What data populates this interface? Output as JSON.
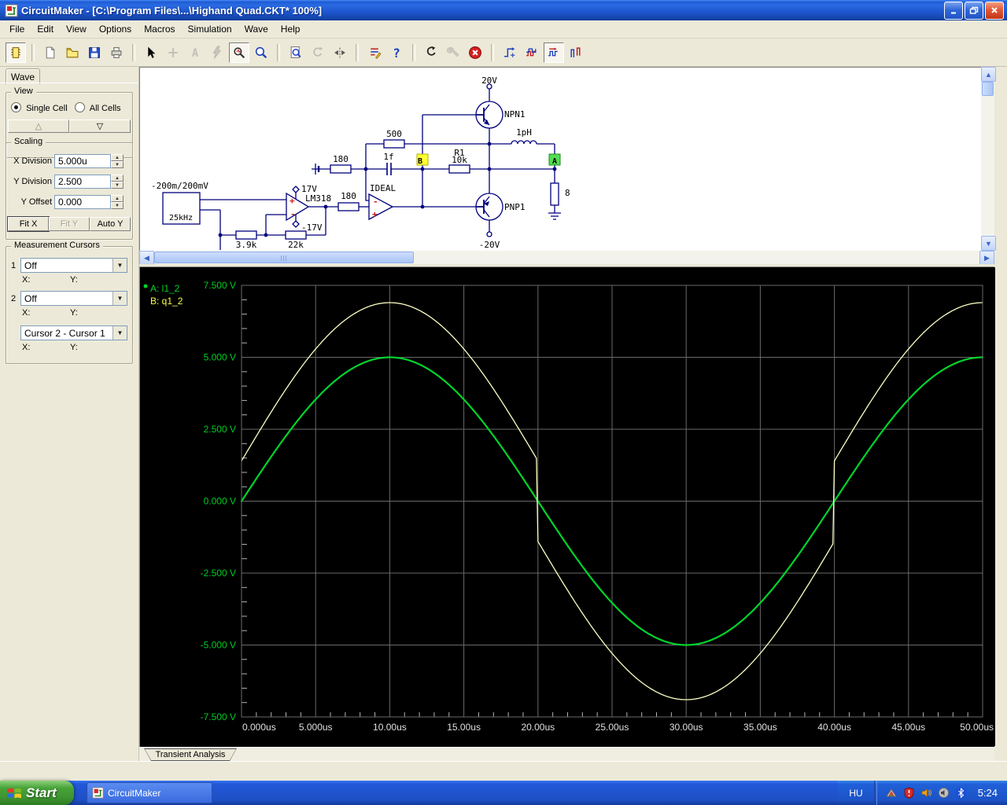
{
  "window": {
    "title": "CircuitMaker - [C:\\Program Files\\...\\Highand Quad.CKT* 100%]",
    "accent_color": "#1c54cc"
  },
  "menu": {
    "items": [
      "File",
      "Edit",
      "View",
      "Options",
      "Macros",
      "Simulation",
      "Wave",
      "Help"
    ]
  },
  "toolbar": {
    "buttons": [
      {
        "name": "parts-bin-icon",
        "type": "chip",
        "pressed": true
      },
      {
        "sep": true
      },
      {
        "name": "new-file-icon",
        "type": "file"
      },
      {
        "name": "open-file-icon",
        "type": "folder"
      },
      {
        "name": "save-icon",
        "type": "floppy"
      },
      {
        "name": "print-icon",
        "type": "printer"
      },
      {
        "sep": true
      },
      {
        "name": "arrow-tool-icon",
        "type": "arrow"
      },
      {
        "name": "wire-tool-icon",
        "type": "plus",
        "disabled": true
      },
      {
        "name": "text-tool-icon",
        "type": "letterA",
        "disabled": true
      },
      {
        "name": "delete-tool-icon",
        "type": "lightning",
        "disabled": true
      },
      {
        "name": "probe-tool-icon",
        "type": "probe",
        "pressed": true
      },
      {
        "name": "zoom-tool-icon",
        "type": "zoom"
      },
      {
        "sep": true
      },
      {
        "name": "zoom-area-icon",
        "type": "pagezoom"
      },
      {
        "name": "rotate-icon",
        "type": "rotate",
        "disabled": true
      },
      {
        "name": "mirror-icon",
        "type": "mirror"
      },
      {
        "sep": true
      },
      {
        "name": "simulation-setup-icon",
        "type": "simlist"
      },
      {
        "name": "help-icon",
        "type": "help"
      },
      {
        "sep": true
      },
      {
        "name": "reset-icon",
        "type": "reset"
      },
      {
        "name": "wrench-icon",
        "type": "wrench",
        "disabled": true
      },
      {
        "name": "stop-icon",
        "type": "stop"
      },
      {
        "sep": true
      },
      {
        "name": "operating-point-icon",
        "type": "wave1"
      },
      {
        "name": "digital-analysis-icon",
        "type": "wave2"
      },
      {
        "name": "transient-analysis-icon",
        "type": "wave3",
        "pressed": true
      },
      {
        "name": "mixed-signal-icon",
        "type": "wave4"
      }
    ]
  },
  "sidebar": {
    "tab": "Wave",
    "view": {
      "label": "View",
      "single_cell": "Single Cell",
      "all_cells": "All Cells",
      "up_glyph": "△",
      "down_glyph": "▽"
    },
    "scaling": {
      "label": "Scaling",
      "x_division_label": "X Division",
      "x_division": "5.000u",
      "y_division_label": "Y Division",
      "y_division": "2.500",
      "y_offset_label": "Y Offset",
      "y_offset": "0.000",
      "fit_x": "Fit X",
      "fit_y": "Fit Y",
      "auto_y": "Auto Y"
    },
    "cursors": {
      "label": "Measurement Cursors",
      "c1_num": "1",
      "c1_value": "Off",
      "c2_num": "2",
      "c2_value": "Off",
      "diff_value": "Cursor 2 - Cursor 1",
      "x_label": "X:",
      "y_label": "Y:"
    }
  },
  "schematic": {
    "labels": {
      "v20": "20V",
      "npn": "NPN1",
      "r500": "500",
      "l1": "1pH",
      "r180_top": "180",
      "c1f": "1f",
      "marker_b": "B",
      "r1_name": "R1",
      "r1_val": "10k",
      "marker_a": "A",
      "r8": "8",
      "pnp": "PNP1",
      "vneg20": "-20V",
      "src_range": "-200m/200mV",
      "src_freq": "25kHz",
      "vpos17": "17V",
      "opamp1": "LM318",
      "vneg17": "-17V",
      "r180_mid": "180",
      "opamp2": "IDEAL",
      "r39k": "3.9k",
      "r22k": "22k",
      "plus": "+",
      "minus": "-"
    },
    "wire_color": "#00007d",
    "marker_b_color": "#ffff33",
    "marker_a_color": "#55dd55"
  },
  "chart_data": {
    "type": "line",
    "title": "Transient Analysis",
    "x_axis": {
      "unit": "us",
      "min": 0,
      "max": 50,
      "major_step": 5,
      "minor_step": 1,
      "tick_labels": [
        "0.000us",
        "5.000us",
        "10.00us",
        "15.00us",
        "20.00us",
        "25.00us",
        "30.00us",
        "35.00us",
        "40.00us",
        "45.00us",
        "50.00us"
      ],
      "label_color": "#e0e0e0"
    },
    "y_axis": {
      "unit": "V",
      "min": -7.5,
      "max": 7.5,
      "major_step": 2.5,
      "minor_step": 0.5,
      "tick_labels": [
        "7.500 V",
        "5.000 V",
        "2.500 V",
        "0.000 V",
        "-2.500 V",
        "-5.000 V",
        "-7.500 V"
      ],
      "label_color": "#00cc22"
    },
    "grid": {
      "show": true,
      "color": "#6a6a6a",
      "tick_color": "#b4b4b4",
      "bg": "#000000"
    },
    "legend": {
      "position": "top-left",
      "entries": [
        {
          "label": "A: l1_2",
          "color": "#00d42c",
          "bullet": true
        },
        {
          "label": "B: q1_2",
          "color": "#ffff44",
          "bullet": false
        }
      ]
    },
    "series": [
      {
        "name": "A: l1_2",
        "color": "#00d42c",
        "stroke_width": 2.2,
        "model": {
          "kind": "sine",
          "amplitude_v": 5.0,
          "period_us": 40,
          "phase_deg": 0,
          "step_offset_v": 0
        },
        "sample_t_us": [
          0,
          2.5,
          5,
          7.5,
          10,
          12.5,
          15,
          17.5,
          20,
          22.5,
          25,
          27.5,
          30,
          32.5,
          35,
          37.5,
          40,
          42.5,
          45,
          47.5,
          50
        ],
        "sample_v": [
          0,
          1.91,
          3.54,
          4.62,
          5,
          4.62,
          3.54,
          1.91,
          0,
          -1.91,
          -3.54,
          -4.62,
          -5,
          -4.62,
          -3.54,
          -1.91,
          0,
          1.91,
          3.54,
          4.62,
          5
        ]
      },
      {
        "name": "B: q1_2",
        "color": "#ffffc4",
        "stroke_width": 1.3,
        "model": {
          "kind": "sine_plus_step",
          "amplitude_v": 5.5,
          "period_us": 40,
          "phase_deg": 0,
          "step_offset_v": 1.4
        },
        "discontinuities_us": [
          20,
          40
        ],
        "sample_t_us": [
          0,
          2.5,
          5,
          7.5,
          10,
          12.5,
          15,
          17.5,
          20,
          22.5,
          25,
          27.5,
          30,
          32.5,
          35,
          37.5,
          40,
          42.5,
          45,
          47.5,
          50
        ],
        "sample_v": [
          1.4,
          3.5,
          5.29,
          6.48,
          6.9,
          6.48,
          5.29,
          3.5,
          -1.4,
          -3.5,
          -5.29,
          -6.48,
          -6.9,
          -6.48,
          -5.29,
          -3.5,
          1.4,
          3.5,
          5.29,
          6.48,
          6.9
        ]
      }
    ]
  },
  "bottom_tab": "Transient Analysis",
  "taskbar": {
    "start": "Start",
    "task": "CircuitMaker",
    "lang": "HU",
    "time": "5:24",
    "tray_icons": [
      {
        "name": "graphics-utility-icon"
      },
      {
        "name": "security-shield-icon"
      },
      {
        "name": "volume-icon"
      },
      {
        "name": "sound-device-icon"
      },
      {
        "name": "bluetooth-icon"
      }
    ]
  }
}
